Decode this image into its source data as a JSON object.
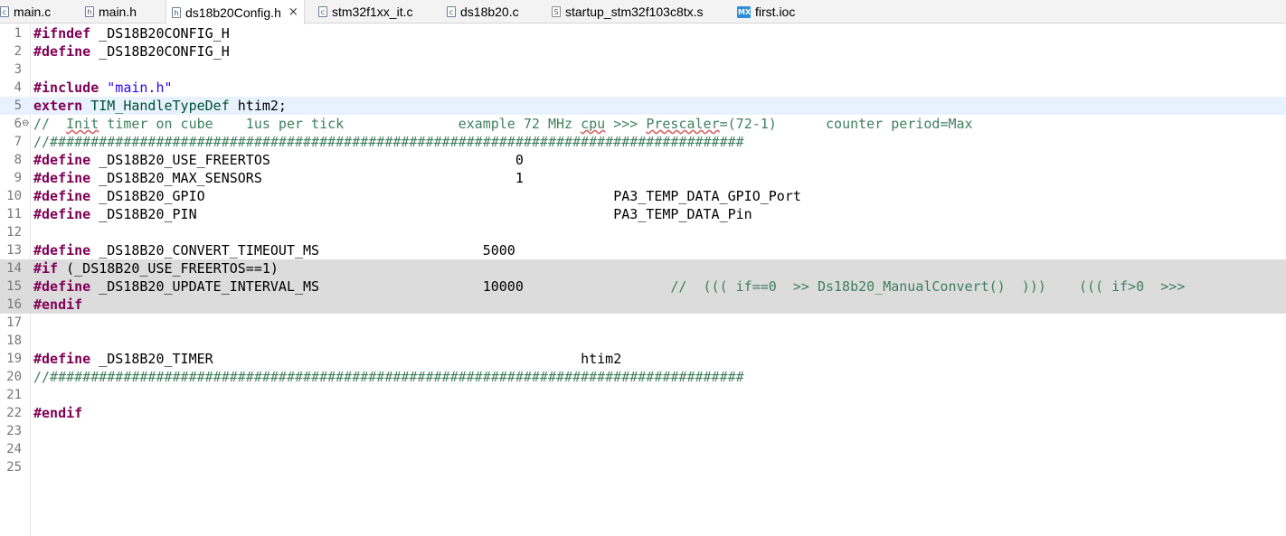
{
  "tabs": [
    {
      "label": "main.c",
      "icon": "c-file-icon",
      "glyph": "c"
    },
    {
      "label": "main.h",
      "icon": "h-file-icon",
      "glyph": "h"
    },
    {
      "label": "ds18b20Config.h",
      "icon": "h-file-icon",
      "glyph": "h",
      "active": true,
      "close": "×"
    },
    {
      "label": "stm32f1xx_it.c",
      "icon": "c-file-icon",
      "glyph": "c"
    },
    {
      "label": "ds18b20.c",
      "icon": "c-file-icon",
      "glyph": "c"
    },
    {
      "label": "startup_stm32f103c8tx.s",
      "icon": "s-file-icon",
      "glyph": "S"
    },
    {
      "label": "first.ioc",
      "icon": "mx-file-icon",
      "glyph": "MX"
    }
  ],
  "editor": {
    "lines": [
      {
        "n": "1",
        "k": "#ifndef",
        "t": " _DS18B20CONFIG_H"
      },
      {
        "n": "2",
        "k": "#define",
        "t": " _DS18B20CONFIG_H"
      },
      {
        "n": "3"
      },
      {
        "n": "4",
        "k": "#include",
        "t": " ",
        "s": "\"main.h\""
      },
      {
        "n": "5",
        "k": "extern",
        "t": " ",
        "ty": "TIM_HandleTypeDef",
        "t2": " htim2;"
      },
      {
        "n": "6",
        "fold": "⊖",
        "c1": "//  ",
        "c1sq": "Init",
        "c2": " timer on cube    1us per tick              example 72 MHz ",
        "c2sq": "cpu",
        "c3": " >>> ",
        "c3sq": "Prescaler",
        "c4": "=(72-1)      counter period=Max"
      },
      {
        "n": "7",
        "cm": "//#####################################################################################"
      },
      {
        "n": "8",
        "k": "#define",
        "t": " _DS18B20_USE_FREERTOS                              0"
      },
      {
        "n": "9",
        "k": "#define",
        "t": " _DS18B20_MAX_SENSORS                               1"
      },
      {
        "n": "10",
        "k": "#define",
        "t": " _DS18B20_GPIO                                                  PA3_TEMP_DATA_GPIO_Port"
      },
      {
        "n": "11",
        "k": "#define",
        "t": " _DS18B20_PIN                                                   PA3_TEMP_DATA_Pin"
      },
      {
        "n": "12"
      },
      {
        "n": "13",
        "k": "#define",
        "t": " _DS18B20_CONVERT_TIMEOUT_MS                    5000"
      },
      {
        "n": "14",
        "k": "#if",
        "t": " (_DS18B20_USE_FREERTOS==1)"
      },
      {
        "n": "15",
        "k": "#define",
        "t": " _DS18B20_UPDATE_INTERVAL_MS                    10000                  ",
        "cm": "//  ((( if==0  >> Ds18b20_ManualConvert()  )))    ((( if>0  >>>"
      },
      {
        "n": "16",
        "k": "#endif"
      },
      {
        "n": "17"
      },
      {
        "n": "18"
      },
      {
        "n": "19",
        "k": "#define",
        "t": " _DS18B20_TIMER                                             htim2"
      },
      {
        "n": "20",
        "cm": "//#####################################################################################"
      },
      {
        "n": "21"
      },
      {
        "n": "22",
        "k": "#endif"
      },
      {
        "n": "23"
      },
      {
        "n": "24"
      },
      {
        "n": "25"
      }
    ]
  },
  "colors": {
    "keyword": "#7f0055",
    "string": "#2a00ff",
    "comment": "#3f7f5f",
    "type": "#005032",
    "current_line": "#e8f2fe",
    "inactive_block": "#dcdcdc"
  }
}
